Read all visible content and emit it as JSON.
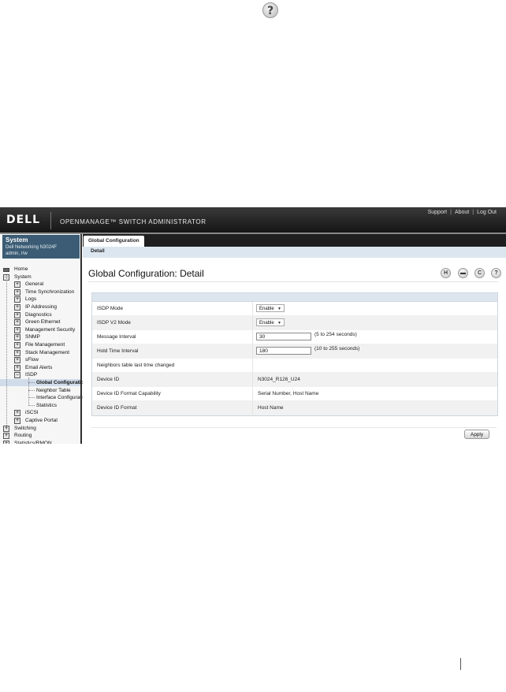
{
  "top_help_icon": "help-icon",
  "header": {
    "logo": "DELL",
    "app_title": "OPENMANAGE™ SWITCH ADMINISTRATOR",
    "links": [
      "Support",
      "About",
      "Log Out"
    ]
  },
  "sidebar": {
    "system_title": "System",
    "device": "Dell Networking N3024F",
    "user": "admin, r/w",
    "tree": [
      {
        "label": "Home",
        "level": 0,
        "icon": "home-icon"
      },
      {
        "label": "System",
        "level": 0,
        "icon": "minus-box-icon"
      },
      {
        "label": "General",
        "level": 1,
        "icon": "plus-box-icon"
      },
      {
        "label": "Time Synchronization",
        "level": 1,
        "icon": "plus-box-icon"
      },
      {
        "label": "Logs",
        "level": 1,
        "icon": "plus-box-icon"
      },
      {
        "label": "IP Addressing",
        "level": 1,
        "icon": "plus-box-icon"
      },
      {
        "label": "Diagnostics",
        "level": 1,
        "icon": "plus-box-icon"
      },
      {
        "label": "Green Ethernet",
        "level": 1,
        "icon": "plus-box-icon"
      },
      {
        "label": "Management Security",
        "level": 1,
        "icon": "plus-box-icon"
      },
      {
        "label": "SNMP",
        "level": 1,
        "icon": "plus-box-icon"
      },
      {
        "label": "File Management",
        "level": 1,
        "icon": "plus-box-icon"
      },
      {
        "label": "Stack Management",
        "level": 1,
        "icon": "plus-box-icon"
      },
      {
        "label": "sFlow",
        "level": 1,
        "icon": "plus-box-icon"
      },
      {
        "label": "Email Alerts",
        "level": 1,
        "icon": "plus-box-icon"
      },
      {
        "label": "ISDP",
        "level": 1,
        "icon": "minus-box-icon"
      },
      {
        "label": "Global Configuration",
        "level": 2,
        "icon": "",
        "selected": true
      },
      {
        "label": "Neighbor Table",
        "level": 2,
        "icon": ""
      },
      {
        "label": "Interface Configuration",
        "level": 2,
        "icon": ""
      },
      {
        "label": "Statistics",
        "level": 2,
        "icon": ""
      },
      {
        "label": "iSCSI",
        "level": 1,
        "icon": "plus-box-icon"
      },
      {
        "label": "Captive Portal",
        "level": 1,
        "icon": "plus-box-icon"
      },
      {
        "label": "Switching",
        "level": 0,
        "icon": "plus-box-icon"
      },
      {
        "label": "Routing",
        "level": 0,
        "icon": "plus-box-icon"
      },
      {
        "label": "Statistics/RMON",
        "level": 0,
        "icon": "plus-box-icon"
      }
    ]
  },
  "tabs": {
    "main": "Global Configuration",
    "sub": "Detail"
  },
  "page": {
    "title": "Global Configuration: Detail",
    "icons": [
      "save-icon",
      "print-icon",
      "refresh-icon",
      "help-icon"
    ]
  },
  "form": {
    "rows": [
      {
        "label": "ISDP Mode",
        "type": "select",
        "value": "Enable"
      },
      {
        "label": "ISDP V2 Mode",
        "type": "select",
        "value": "Enable"
      },
      {
        "label": "Message Interval",
        "type": "input",
        "value": "30",
        "hint": "(5 to 254 seconds)"
      },
      {
        "label": "Hold Time Interval",
        "type": "input",
        "value": "180",
        "hint": "(10 to 255 seconds)"
      },
      {
        "label": "Neighbors table last time changed",
        "type": "text",
        "value": ""
      },
      {
        "label": "Device ID",
        "type": "text",
        "value": "N3024_R126_U24"
      },
      {
        "label": "Device ID Format Capability",
        "type": "text",
        "value": "Serial Number, Host Name"
      },
      {
        "label": "Device ID Format",
        "type": "text",
        "value": "Host Name"
      }
    ],
    "apply_label": "Apply"
  }
}
